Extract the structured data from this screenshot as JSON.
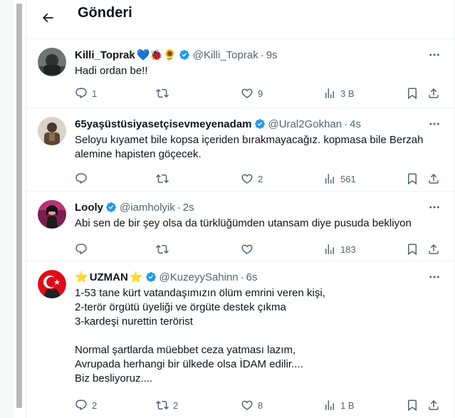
{
  "header": {
    "title": "Gönderi"
  },
  "tweets": [
    {
      "name": "Killi_Toprak",
      "emojis": "💙🐞🌻",
      "handle": "@Killi_Toprak",
      "time": "9s",
      "lines": [
        "Hadi ordan be!!"
      ],
      "replies": "1",
      "retweets": "",
      "likes": "9",
      "views": "3 B"
    },
    {
      "name": "65yaşüstüsiyasetçisevmeyenadam",
      "emojis": "",
      "handle": "@Ural2Gokhan",
      "time": "4s",
      "lines": [
        "Seloyu kıyamet bile kopsa içeriden bırakmayacağız. kopmasa bile Berzah",
        "alemine hapisten göçecek."
      ],
      "replies": "",
      "retweets": "",
      "likes": "2",
      "views": "561"
    },
    {
      "name": "Looly",
      "emojis": "",
      "handle": "@iamholyik",
      "time": "2s",
      "lines": [
        "Abi sen de bir şey olsa da türklüğümden utansam diye pusuda bekliyon"
      ],
      "replies": "",
      "retweets": "",
      "likes": "",
      "views": "183"
    },
    {
      "name_prefix": "⭐",
      "name": "UZMAN",
      "emojis": "⭐",
      "handle": "@KuzeyySahinn",
      "time": "6s",
      "lines": [
        "1-53 tane kürt vatandaşımızın ölüm emrini veren kişi,",
        "2-terör örgütü üyeliği ve örgüte destek çıkma",
        "3-kardeşi nurettin terörist",
        "",
        "Normal şartlarda müebbet ceza yatması lazım,",
        "Avrupada herhangi bir ülkede olsa İDAM edilir....",
        "Biz besliyoruz...."
      ],
      "replies": "2",
      "retweets": "2",
      "likes": "8",
      "views": "1 B"
    }
  ],
  "icons": {
    "back": "arrow-left-icon",
    "verified": "verified-badge-icon",
    "more": "more-horizontal-icon",
    "reply": "reply-icon",
    "retweet": "retweet-icon",
    "like": "heart-icon",
    "views": "views-icon",
    "bookmark": "bookmark-icon",
    "share": "share-icon"
  },
  "colors": {
    "verified": "#1d9bf0",
    "text": "#0f1419",
    "secondary": "#536471"
  }
}
